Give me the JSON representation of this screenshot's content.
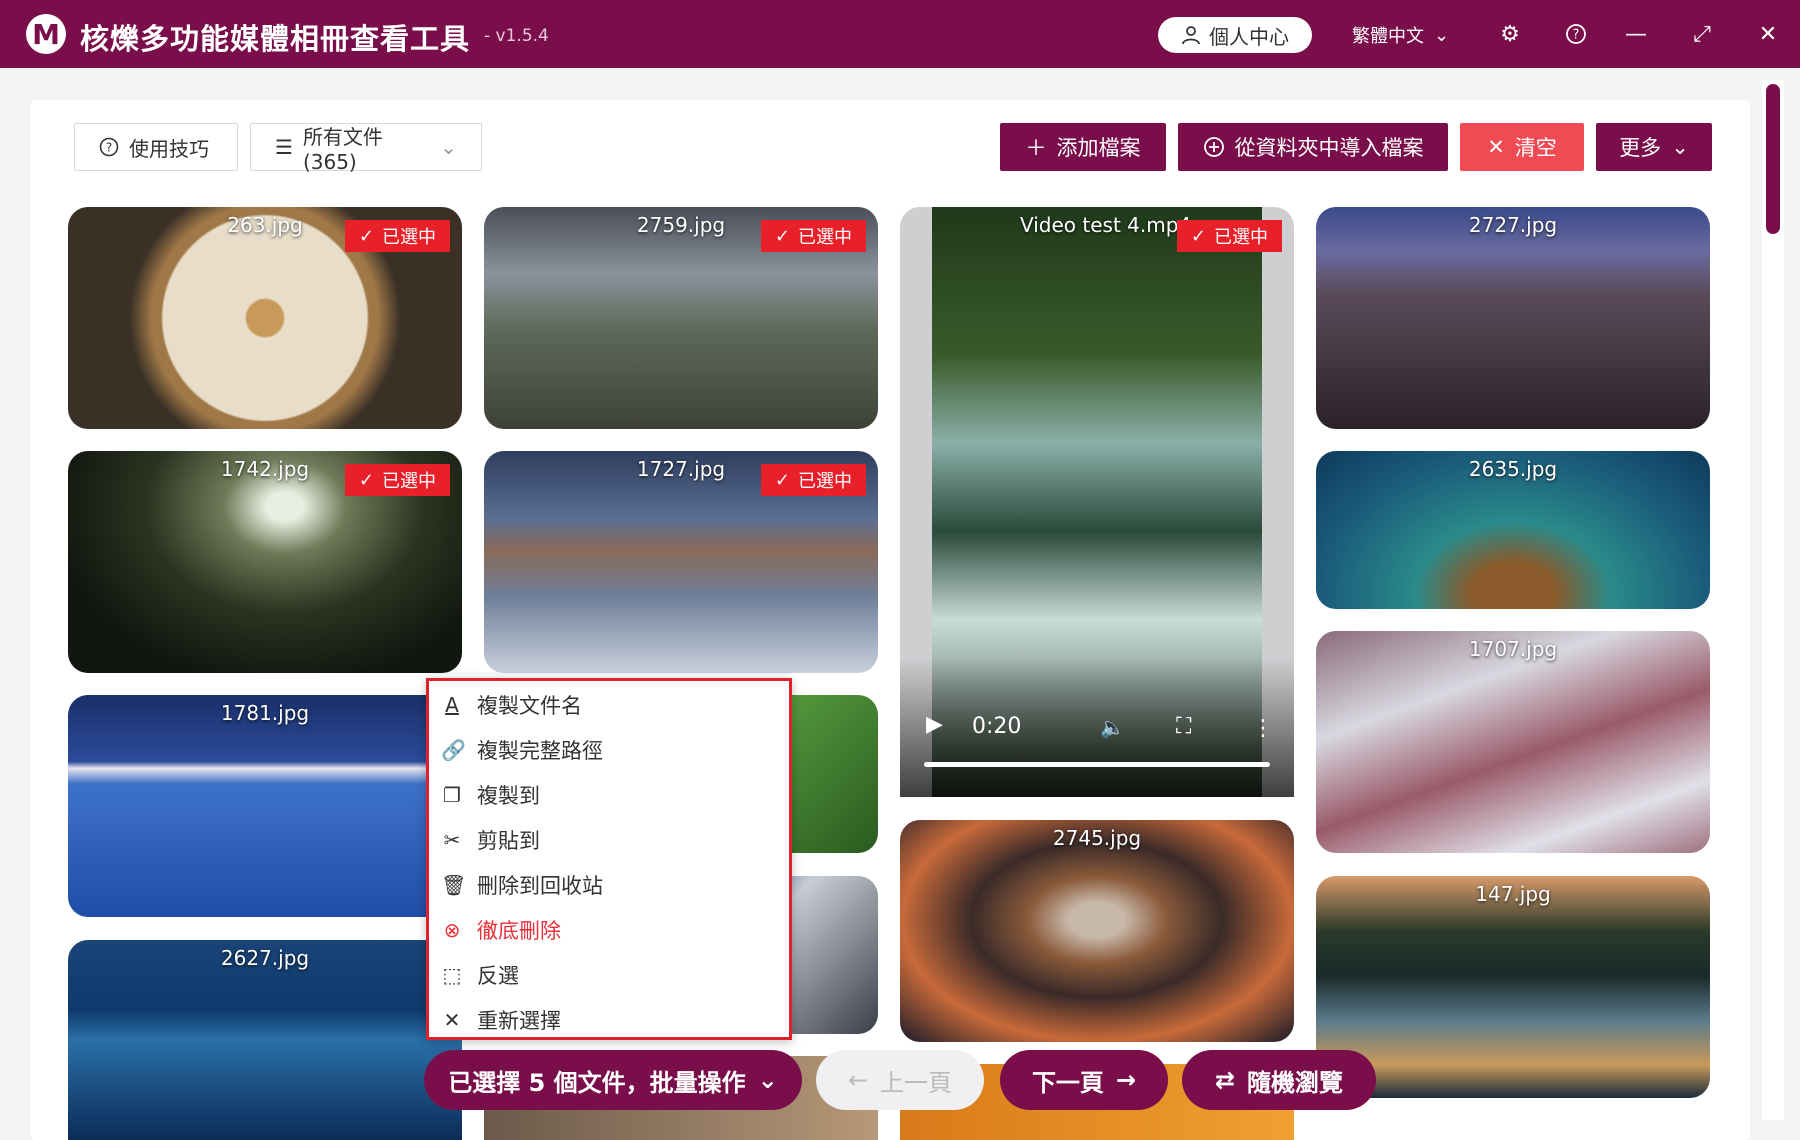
{
  "app": {
    "logo_letter": "M",
    "title": "核爍多功能媒體相冊查看工具",
    "version": "- v1.5.4",
    "profile_label": "個人中心",
    "language": "繁體中文"
  },
  "colors": {
    "brand": "#7a0e4a",
    "danger": "#f04a55",
    "badge": "#e8202a"
  },
  "toolbar": {
    "tips_label": "使用技巧",
    "filter_label": "所有文件 (365)",
    "add_label": "添加檔案",
    "import_label": "從資料夾中導入檔案",
    "clear_label": "清空",
    "more_label": "更多"
  },
  "selected_badge": "已選中",
  "thumbnails": [
    {
      "name": "263.jpg",
      "selected": true
    },
    {
      "name": "2759.jpg",
      "selected": true
    },
    {
      "name": "Video test 4.mp4",
      "selected": true,
      "video_time": "0:20"
    },
    {
      "name": "2727.jpg",
      "selected": false
    },
    {
      "name": "1742.jpg",
      "selected": true
    },
    {
      "name": "1727.jpg",
      "selected": true
    },
    {
      "name": "2635.jpg",
      "selected": false
    },
    {
      "name": "1781.jpg",
      "selected": false
    },
    {
      "name": "1707.jpg",
      "selected": false
    },
    {
      "name": "2745.jpg",
      "selected": false
    },
    {
      "name": "2627.jpg",
      "selected": false
    },
    {
      "name": "147.jpg",
      "selected": false
    }
  ],
  "context_menu": [
    {
      "label": "複製文件名",
      "icon": "text-a-icon"
    },
    {
      "label": "複製完整路徑",
      "icon": "link-icon"
    },
    {
      "label": "複製到",
      "icon": "copy-icon"
    },
    {
      "label": "剪貼到",
      "icon": "scissors-icon"
    },
    {
      "label": "刪除到回收站",
      "icon": "trash-icon"
    },
    {
      "label": "徹底刪除",
      "icon": "circle-x-icon",
      "danger": true
    },
    {
      "label": "反選",
      "icon": "invert-select-icon"
    },
    {
      "label": "重新選擇",
      "icon": "close-icon"
    }
  ],
  "bottom_bar": {
    "batch_label": "已選擇 5 個文件，批量操作",
    "prev_label": "上一頁",
    "next_label": "下一頁",
    "random_label": "隨機瀏覽"
  }
}
